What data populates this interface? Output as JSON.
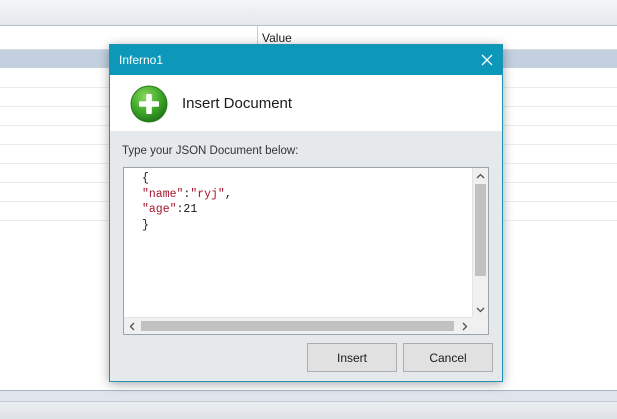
{
  "background": {
    "header_value_label": "Value"
  },
  "dialog": {
    "window_title": "Inferno1",
    "heading": "Insert Document",
    "prompt": "Type your JSON Document below:",
    "editor": {
      "lines": {
        "open_brace": "{",
        "name_key": "\"name\"",
        "name_sep": ":",
        "name_value": "\"ryj\"",
        "name_comma": ",",
        "age_key": "\"age\"",
        "age_sep": ":",
        "age_value": "21",
        "close_brace": "}"
      }
    },
    "buttons": {
      "insert_label": "Insert",
      "cancel_label": "Cancel"
    }
  },
  "icons": {
    "close": "close-icon",
    "plus": "plus-circle-icon",
    "scroll_up": "chevron-up-icon",
    "scroll_down": "chevron-down-icon",
    "scroll_left": "chevron-left-icon",
    "scroll_right": "chevron-right-icon"
  },
  "colors": {
    "titlebar": "#0d97b8",
    "selected_row": "#c2d0e0",
    "plus_green": "#3fa82a",
    "json_string": "#a3152d"
  }
}
